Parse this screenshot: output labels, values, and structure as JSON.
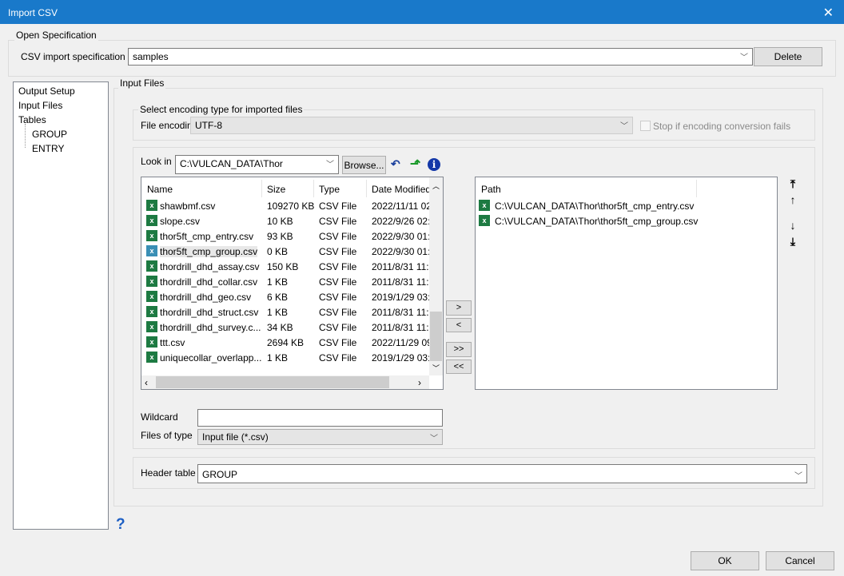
{
  "window": {
    "title": "Import CSV",
    "close": "✕"
  },
  "open_spec": {
    "group_label": "Open Specification",
    "label": "CSV import specification",
    "value": "samples",
    "delete": "Delete"
  },
  "tree": {
    "items": [
      "Output Setup",
      "Input Files",
      "Tables",
      "GROUP",
      "ENTRY"
    ]
  },
  "input_files": {
    "group_label": "Input Files",
    "encoding": {
      "group_label": "Select encoding type for imported files",
      "label": "File encoding",
      "value": "UTF-8",
      "stop_label": "Stop if encoding conversion fails"
    },
    "look_in": {
      "label": "Look in",
      "value": "C:\\VULCAN_DATA\\Thor",
      "browse": "Browse..."
    },
    "columns": [
      "Name",
      "Size",
      "Type",
      "Date Modified"
    ],
    "files": [
      [
        "shawbmf.csv",
        "109270 KB",
        "CSV File",
        "2022/11/11 02"
      ],
      [
        "slope.csv",
        "10 KB",
        "CSV File",
        "2022/9/26 02:"
      ],
      [
        "thor5ft_cmp_entry.csv",
        "93 KB",
        "CSV File",
        "2022/9/30 01:"
      ],
      [
        "thor5ft_cmp_group.csv",
        "0 KB",
        "CSV File",
        "2022/9/30 01:"
      ],
      [
        "thordrill_dhd_assay.csv",
        "150 KB",
        "CSV File",
        "2011/8/31 11:"
      ],
      [
        "thordrill_dhd_collar.csv",
        "1 KB",
        "CSV File",
        "2011/8/31 11:"
      ],
      [
        "thordrill_dhd_geo.csv",
        "6 KB",
        "CSV File",
        "2019/1/29 03:"
      ],
      [
        "thordrill_dhd_struct.csv",
        "1 KB",
        "CSV File",
        "2011/8/31 11:"
      ],
      [
        "thordrill_dhd_survey.c...",
        "34 KB",
        "CSV File",
        "2011/8/31 11:"
      ],
      [
        "ttt.csv",
        "2694 KB",
        "CSV File",
        "2022/11/29 09"
      ],
      [
        "uniquecollar_overlapp...",
        "1 KB",
        "CSV File",
        "2019/1/29 03:"
      ]
    ],
    "move_buttons": [
      ">",
      "<",
      ">>",
      "<<"
    ],
    "path_header": "Path",
    "paths": [
      "C:\\VULCAN_DATA\\Thor\\thor5ft_cmp_entry.csv",
      "C:\\VULCAN_DATA\\Thor\\thor5ft_cmp_group.csv"
    ],
    "order_arrows": [
      "⤒",
      "↑",
      "↓",
      "⤓"
    ],
    "wildcard_label": "Wildcard",
    "wildcard_value": "",
    "files_of_type_label": "Files of type",
    "files_of_type_value": "Input file (*.csv)",
    "header_table_label": "Header table",
    "header_table_value": "GROUP"
  },
  "help": "?",
  "footer": {
    "ok": "OK",
    "cancel": "Cancel"
  }
}
